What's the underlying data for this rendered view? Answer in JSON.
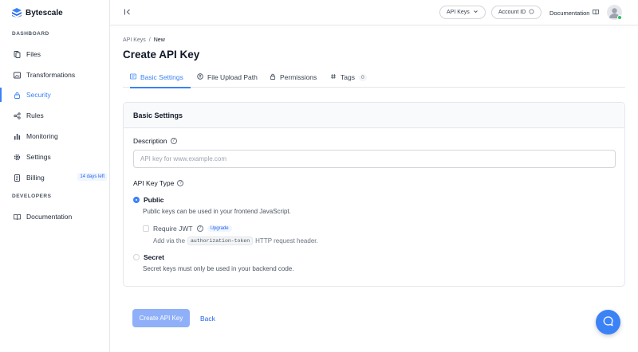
{
  "brand": {
    "name": "Bytescale",
    "accent": "#3b82f6"
  },
  "sidebar": {
    "dashboard_label": "DASHBOARD",
    "developers_label": "DEVELOPERS",
    "items": [
      {
        "label": "Files",
        "icon": "files-icon"
      },
      {
        "label": "Transformations",
        "icon": "image-icon"
      },
      {
        "label": "Security",
        "icon": "lock-icon",
        "active": true
      },
      {
        "label": "Rules",
        "icon": "share-icon"
      },
      {
        "label": "Monitoring",
        "icon": "bar-chart-icon"
      },
      {
        "label": "Settings",
        "icon": "gear-icon"
      },
      {
        "label": "Billing",
        "icon": "document-icon",
        "badge": "14 days left"
      }
    ],
    "dev_items": [
      {
        "label": "Documentation",
        "icon": "book-icon"
      }
    ]
  },
  "topbar": {
    "api_keys_label": "API Keys",
    "account_id_label": "Account ID",
    "documentation_label": "Documentation"
  },
  "breadcrumb": {
    "parent": "API Keys",
    "separator": "/",
    "current": "New"
  },
  "page": {
    "title": "Create API Key"
  },
  "tabs": [
    {
      "label": "Basic Settings",
      "active": true
    },
    {
      "label": "File Upload Path"
    },
    {
      "label": "Permissions"
    },
    {
      "label": "Tags",
      "count": "0"
    }
  ],
  "form": {
    "section_title": "Basic Settings",
    "description_label": "Description",
    "description_placeholder": "API key for www.example.com",
    "description_value": "",
    "key_type_label": "API Key Type",
    "public_label": "Public",
    "public_desc": "Public keys can be used in your frontend JavaScript.",
    "require_jwt_label": "Require JWT",
    "upgrade_label": "Upgrade",
    "jwt_desc_prefix": "Add via the",
    "jwt_desc_code": "authorization-token",
    "jwt_desc_suffix": "HTTP request header.",
    "secret_label": "Secret",
    "secret_desc": "Secret keys must only be used in your backend code."
  },
  "actions": {
    "create_label": "Create API Key",
    "back_label": "Back"
  }
}
